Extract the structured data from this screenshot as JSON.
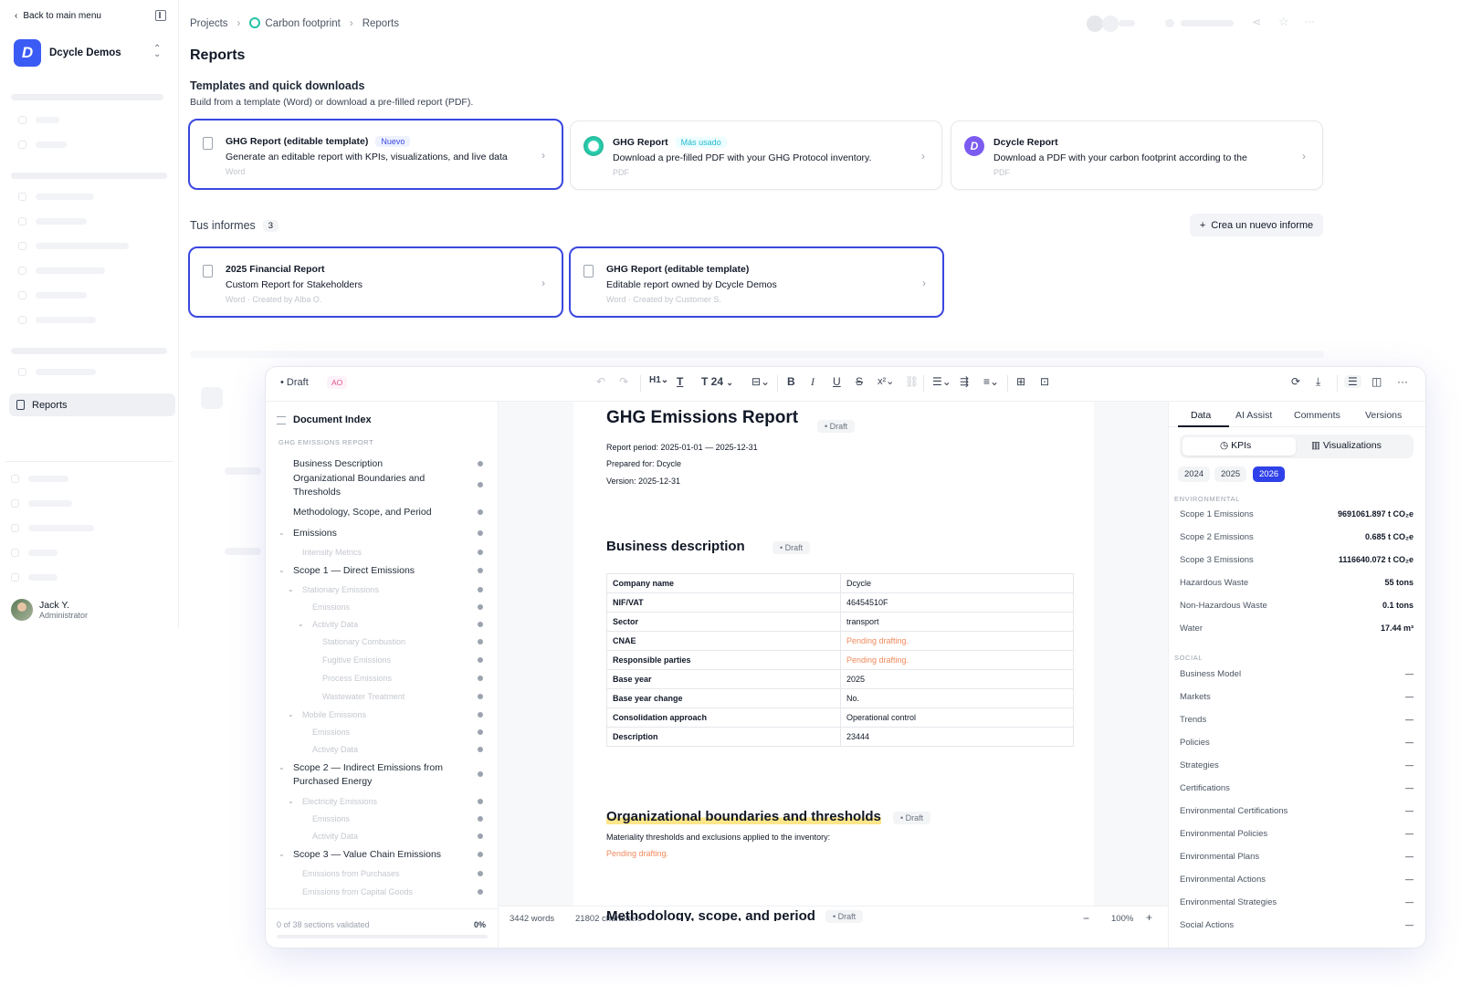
{
  "sidebar": {
    "back_label": "Back to main menu",
    "org_name": "Dcycle Demos",
    "reports_label": "Reports",
    "user_name": "Jack Y.",
    "user_role": "Administrator"
  },
  "breadcrumb": [
    "Projects",
    "Carbon footprint",
    "Reports"
  ],
  "page_title": "Reports",
  "templates": {
    "heading": "Templates and quick downloads",
    "subtitle": "Build from a template (Word) or download a pre-filled report (PDF).",
    "cards": [
      {
        "title": "GHG Report (editable template)",
        "badge": "Nuevo",
        "desc": "Generate an editable report with KPIs, visualizations, and live data",
        "format": "Word"
      },
      {
        "title": "GHG Report",
        "badge": "Más usado",
        "desc": "Download a pre-filled PDF with your GHG Protocol inventory.",
        "format": "PDF"
      },
      {
        "title": "Dcycle Report",
        "badge": "",
        "desc": "Download a PDF with your carbon footprint according to the",
        "format": "PDF"
      }
    ]
  },
  "my_reports": {
    "heading": "Tus informes",
    "count": "3",
    "new_button": "Crea un nuevo informe",
    "cards": [
      {
        "title": "2025 Financial Report",
        "desc": "Custom Report for Stakeholders",
        "meta": "Word · Created by Alba O."
      },
      {
        "title": "GHG Report (editable template)",
        "desc": "Editable report owned by Dcycle Demos",
        "meta": "Word · Created by Customer S."
      }
    ]
  },
  "editor": {
    "status": "Draft",
    "initials": "AO",
    "heading_level": "H1",
    "font_size": "24",
    "index": {
      "title": "Document Index",
      "caption": "GHG EMISSIONS REPORT",
      "footer": "0 of 38 sections validated",
      "progress": "0%"
    },
    "document": {
      "title": "GHG Emissions Report",
      "status": "Draft",
      "period": "Report period: 2025-01-01 — 2025-12-31",
      "prepared": "Prepared for: Dcycle",
      "version": "Version: 2025-12-31",
      "business_heading": "Business description",
      "rows": [
        {
          "k": "Company name",
          "v": "Dcycle",
          "pending": false
        },
        {
          "k": "NIF/VAT",
          "v": "46454510F",
          "pending": false
        },
        {
          "k": "Sector",
          "v": "transport",
          "pending": false
        },
        {
          "k": "CNAE",
          "v": "Pending drafting.",
          "pending": true
        },
        {
          "k": "Responsible parties",
          "v": "Pending drafting.",
          "pending": true
        },
        {
          "k": "Base year",
          "v": "2025",
          "pending": false
        },
        {
          "k": "Base year change",
          "v": "No.",
          "pending": false
        },
        {
          "k": "Consolidation approach",
          "v": "Operational control",
          "pending": false
        },
        {
          "k": "Description",
          "v": "23444",
          "pending": false
        }
      ],
      "org_heading": "Organizational boundaries and thresholds",
      "org_text": "Materiality thresholds and exclusions applied to the inventory:",
      "org_pending": "Pending drafting.",
      "method_heading": "Methodology, scope, and period",
      "words": "3442 words",
      "chars": "21802 characters",
      "zoom": "100%"
    },
    "panel": {
      "tabs": [
        "Data",
        "AI Assist",
        "Comments",
        "Versions"
      ],
      "kpis_label": "KPIs",
      "viz_label": "Visualizations",
      "years": [
        "2024",
        "2025",
        "2026"
      ],
      "env_caption": "ENVIRONMENTAL",
      "env": [
        {
          "k": "Scope 1 Emissions",
          "v": "9691061.897 t CO₂e"
        },
        {
          "k": "Scope 2 Emissions",
          "v": "0.685 t CO₂e"
        },
        {
          "k": "Scope 3 Emissions",
          "v": "1116640.072 t CO₂e"
        },
        {
          "k": "Hazardous Waste",
          "v": "55 tons"
        },
        {
          "k": "Non-Hazardous Waste",
          "v": "0.1 tons"
        },
        {
          "k": "Water",
          "v": "17.44 m³"
        }
      ],
      "social_caption": "SOCIAL",
      "social": [
        "Business Model",
        "Markets",
        "Trends",
        "Policies",
        "Strategies",
        "Certifications",
        "Environmental Certifications",
        "Environmental Policies",
        "Environmental Plans",
        "Environmental Actions",
        "Environmental Strategies",
        "Social Actions"
      ],
      "dash": "—"
    }
  }
}
